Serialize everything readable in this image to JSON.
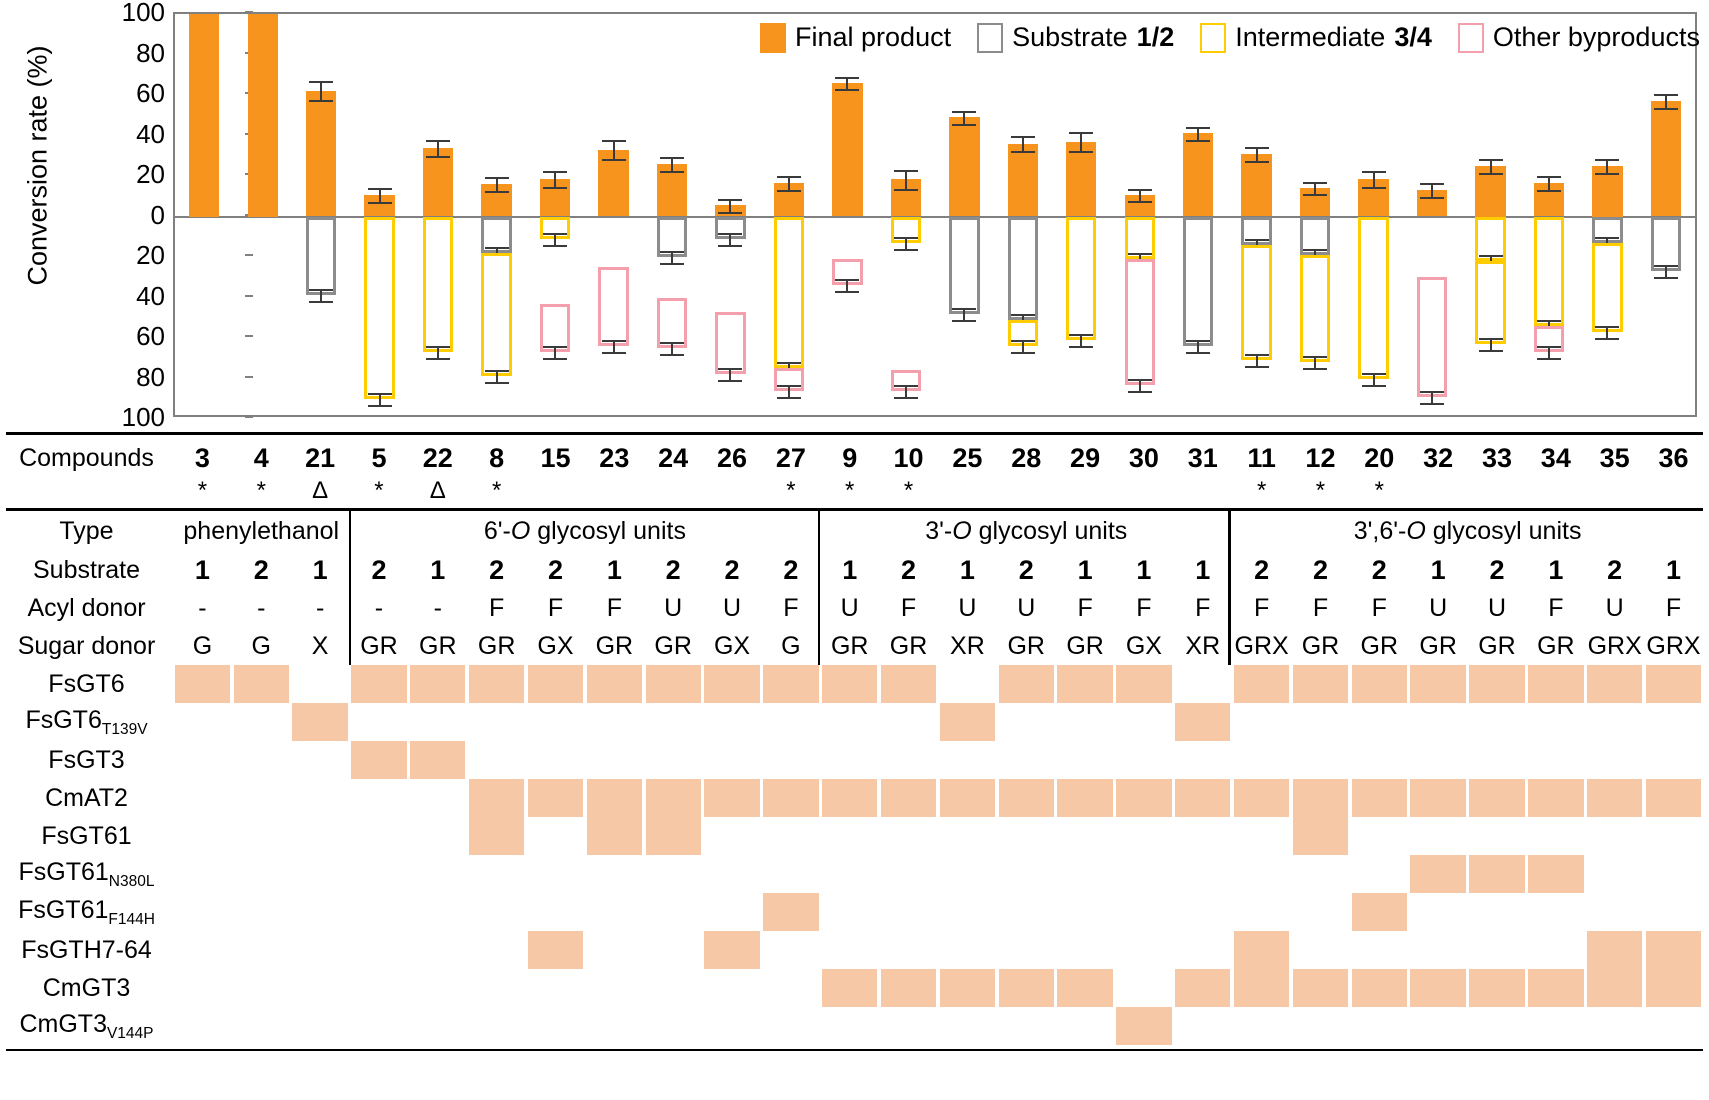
{
  "chart_data": {
    "type": "bar",
    "title": "",
    "ylabel": "Conversion rate (%)",
    "xlabel": "",
    "ylim": [
      -100,
      100
    ],
    "yticks": [
      100,
      80,
      60,
      40,
      20,
      0,
      20,
      40,
      60,
      80,
      100
    ],
    "grid": false,
    "legend_position": "top-right",
    "legend": [
      {
        "key": "final",
        "label": "Final product",
        "bold_suffix": "",
        "color": "#F7941D",
        "style": "filled"
      },
      {
        "key": "substrate",
        "label": "Substrate ",
        "bold_suffix": "1/2",
        "color": "#8C8C8C",
        "style": "outline"
      },
      {
        "key": "intermediate",
        "label": "Intermediate ",
        "bold_suffix": "3/4",
        "color": "#FFCC00",
        "style": "outline"
      },
      {
        "key": "other",
        "label": "Other byproducts",
        "bold_suffix": "",
        "color": "#F4A0AC",
        "style": "outline"
      }
    ],
    "categories": [
      "3",
      "4",
      "21",
      "5",
      "22",
      "8",
      "15",
      "23",
      "24",
      "26",
      "27",
      "9",
      "10",
      "25",
      "28",
      "29",
      "30",
      "31",
      "11",
      "12",
      "20",
      "32",
      "33",
      "34",
      "35",
      "36"
    ],
    "series": [
      {
        "name": "Final product",
        "values": [
          100,
          100,
          62,
          10.5,
          34,
          16,
          18.5,
          33,
          26,
          5.5,
          16.5,
          66,
          18.5,
          49,
          36,
          37,
          10.5,
          41,
          31,
          14,
          18.5,
          13,
          25,
          16.5,
          25,
          57
        ]
      },
      {
        "name": "Substrate 1/2",
        "values": [
          0,
          0,
          39,
          0,
          0,
          0,
          0,
          0,
          0,
          0,
          0,
          0,
          0,
          48,
          0,
          0,
          0,
          64,
          14,
          17,
          0,
          0,
          0,
          0,
          13,
          27
        ]
      },
      {
        "name": "Intermediate 3/4",
        "values": [
          0,
          0,
          0,
          90,
          67,
          22,
          11,
          0,
          20,
          11,
          0,
          20,
          13,
          0,
          51,
          61,
          21,
          0,
          52,
          55,
          80,
          0,
          62,
          0,
          57,
          0
        ]
      },
      {
        "name": "Other byproducts",
        "values": [
          0,
          0,
          0,
          0,
          0,
          0,
          56,
          64,
          0,
          55,
          76,
          34,
          67,
          0,
          0,
          0,
          59,
          0,
          0,
          0,
          0,
          90,
          0,
          54,
          0,
          0
        ]
      }
    ],
    "error_bars": [
      1.5,
      1.0,
      2.0,
      1.2,
      1.5,
      1.3,
      1.5,
      2.0,
      1.2,
      1.0,
      1.2,
      1.0,
      2.0,
      1.0,
      1.5,
      2.0,
      1.0,
      1.2,
      1.2,
      1.0,
      1.5,
      1.2,
      1.2,
      1.3,
      1.2,
      1.2
    ],
    "stacks": [
      {
        "compound": "3",
        "pos": [
          {
            "type": "final",
            "value": 100
          }
        ],
        "neg": []
      },
      {
        "compound": "4",
        "pos": [
          {
            "type": "final",
            "value": 100
          }
        ],
        "neg": []
      },
      {
        "compound": "21",
        "pos": [
          {
            "type": "final",
            "value": 62
          }
        ],
        "neg": [
          {
            "type": "substrate",
            "from": 0,
            "to": 39
          }
        ]
      },
      {
        "compound": "5",
        "pos": [
          {
            "type": "final",
            "value": 10.5
          }
        ],
        "neg": [
          {
            "type": "intermediate",
            "from": 0,
            "to": 90
          }
        ]
      },
      {
        "compound": "22",
        "pos": [
          {
            "type": "final",
            "value": 34
          }
        ],
        "neg": [
          {
            "type": "intermediate",
            "from": 0,
            "to": 67
          }
        ]
      },
      {
        "compound": "8",
        "pos": [
          {
            "type": "final",
            "value": 16
          }
        ],
        "neg": [
          {
            "type": "substrate",
            "from": 0,
            "to": 18
          },
          {
            "type": "intermediate",
            "from": 18,
            "to": 79
          }
        ]
      },
      {
        "compound": "15",
        "pos": [
          {
            "type": "final",
            "value": 18.5
          }
        ],
        "neg": [
          {
            "type": "intermediate",
            "from": 0,
            "to": 11
          },
          {
            "type": "other",
            "from": 43,
            "to": 67
          }
        ]
      },
      {
        "compound": "23",
        "pos": [
          {
            "type": "final",
            "value": 33
          }
        ],
        "neg": [
          {
            "type": "other",
            "from": 25,
            "to": 64
          }
        ]
      },
      {
        "compound": "24",
        "pos": [
          {
            "type": "final",
            "value": 26
          }
        ],
        "neg": [
          {
            "type": "substrate",
            "from": 0,
            "to": 20
          },
          {
            "type": "other",
            "from": 40,
            "to": 65
          }
        ]
      },
      {
        "compound": "26",
        "pos": [
          {
            "type": "final",
            "value": 5.5
          }
        ],
        "neg": [
          {
            "type": "substrate",
            "from": 0,
            "to": 11
          },
          {
            "type": "other",
            "from": 47,
            "to": 78
          }
        ]
      },
      {
        "compound": "27",
        "pos": [
          {
            "type": "final",
            "value": 16.5
          }
        ],
        "neg": [
          {
            "type": "intermediate",
            "from": 0,
            "to": 75
          },
          {
            "type": "other",
            "from": 75,
            "to": 86
          }
        ]
      },
      {
        "compound": "9",
        "pos": [
          {
            "type": "final",
            "value": 66
          }
        ],
        "neg": [
          {
            "type": "other",
            "from": 21,
            "to": 34
          }
        ]
      },
      {
        "compound": "10",
        "pos": [
          {
            "type": "final",
            "value": 18.5
          }
        ],
        "neg": [
          {
            "type": "intermediate",
            "from": 0,
            "to": 13
          },
          {
            "type": "other",
            "from": 76,
            "to": 86
          }
        ]
      },
      {
        "compound": "25",
        "pos": [
          {
            "type": "final",
            "value": 49
          }
        ],
        "neg": [
          {
            "type": "substrate",
            "from": 0,
            "to": 48
          }
        ]
      },
      {
        "compound": "28",
        "pos": [
          {
            "type": "final",
            "value": 36
          }
        ],
        "neg": [
          {
            "type": "substrate",
            "from": 0,
            "to": 51
          },
          {
            "type": "intermediate",
            "from": 51,
            "to": 64
          }
        ]
      },
      {
        "compound": "29",
        "pos": [
          {
            "type": "final",
            "value": 37
          }
        ],
        "neg": [
          {
            "type": "intermediate",
            "from": 0,
            "to": 61
          }
        ]
      },
      {
        "compound": "30",
        "pos": [
          {
            "type": "final",
            "value": 10.5
          }
        ],
        "neg": [
          {
            "type": "intermediate",
            "from": 0,
            "to": 21
          },
          {
            "type": "other",
            "from": 21,
            "to": 83
          }
        ]
      },
      {
        "compound": "31",
        "pos": [
          {
            "type": "final",
            "value": 41
          }
        ],
        "neg": [
          {
            "type": "substrate",
            "from": 0,
            "to": 64
          }
        ]
      },
      {
        "compound": "11",
        "pos": [
          {
            "type": "final",
            "value": 31
          }
        ],
        "neg": [
          {
            "type": "substrate",
            "from": 0,
            "to": 14
          },
          {
            "type": "intermediate",
            "from": 14,
            "to": 71
          }
        ]
      },
      {
        "compound": "12",
        "pos": [
          {
            "type": "final",
            "value": 14
          }
        ],
        "neg": [
          {
            "type": "substrate",
            "from": 0,
            "to": 19
          },
          {
            "type": "intermediate",
            "from": 19,
            "to": 72
          }
        ]
      },
      {
        "compound": "20",
        "pos": [
          {
            "type": "final",
            "value": 18.5
          }
        ],
        "neg": [
          {
            "type": "intermediate",
            "from": 0,
            "to": 80
          }
        ]
      },
      {
        "compound": "32",
        "pos": [
          {
            "type": "final",
            "value": 13
          }
        ],
        "neg": [
          {
            "type": "other",
            "from": 30,
            "to": 89
          }
        ]
      },
      {
        "compound": "33",
        "pos": [
          {
            "type": "final",
            "value": 25
          }
        ],
        "neg": [
          {
            "type": "intermediate",
            "from": 0,
            "to": 22
          },
          {
            "type": "intermediate",
            "from": 22,
            "to": 63
          }
        ]
      },
      {
        "compound": "34",
        "pos": [
          {
            "type": "final",
            "value": 16.5
          }
        ],
        "neg": [
          {
            "type": "intermediate",
            "from": 0,
            "to": 54
          },
          {
            "type": "other",
            "from": 54,
            "to": 67
          }
        ]
      },
      {
        "compound": "35",
        "pos": [
          {
            "type": "final",
            "value": 25
          }
        ],
        "neg": [
          {
            "type": "substrate",
            "from": 0,
            "to": 13
          },
          {
            "type": "intermediate",
            "from": 13,
            "to": 57
          }
        ]
      },
      {
        "compound": "36",
        "pos": [
          {
            "type": "final",
            "value": 57
          }
        ],
        "neg": [
          {
            "type": "substrate",
            "from": 0,
            "to": 27
          }
        ]
      }
    ]
  },
  "table": {
    "row_labels": {
      "compounds": "Compounds",
      "type": "Type",
      "substrate": "Substrate",
      "acyl_donor": "Acyl donor",
      "sugar_donor": "Sugar donor"
    },
    "compounds": [
      "3",
      "4",
      "21",
      "5",
      "22",
      "8",
      "15",
      "23",
      "24",
      "26",
      "27",
      "9",
      "10",
      "25",
      "28",
      "29",
      "30",
      "31",
      "11",
      "12",
      "20",
      "32",
      "33",
      "34",
      "35",
      "36"
    ],
    "marks": [
      "*",
      "*",
      "Δ",
      "*",
      "Δ",
      "*",
      "",
      "",
      "",
      "",
      "*",
      "*",
      "*",
      "",
      "",
      "",
      "",
      "",
      "*",
      "*",
      "*",
      "",
      "",
      "",
      "",
      ""
    ],
    "type_groups": [
      {
        "label": "phenylethanol",
        "span": 3,
        "italic_prefix": ""
      },
      {
        "label": "6'-O glycosyl units",
        "span": 8
      },
      {
        "label": "3'-O glycosyl units",
        "span": 7
      },
      {
        "label": "3',6'-O glycosyl units",
        "span": 8
      }
    ],
    "substrate": [
      "1",
      "2",
      "1",
      "2",
      "1",
      "2",
      "2",
      "1",
      "2",
      "2",
      "2",
      "1",
      "2",
      "1",
      "2",
      "1",
      "1",
      "1",
      "2",
      "2",
      "2",
      "1",
      "2",
      "1",
      "2",
      "1"
    ],
    "acyl_donor": [
      "-",
      "-",
      "-",
      "-",
      "-",
      "F",
      "F",
      "F",
      "U",
      "U",
      "F",
      "U",
      "F",
      "U",
      "U",
      "F",
      "F",
      "F",
      "F",
      "F",
      "F",
      "U",
      "U",
      "F",
      "U",
      "F"
    ],
    "sugar_donor": [
      "G",
      "G",
      "X",
      "GR",
      "GR",
      "GR",
      "GX",
      "GR",
      "GR",
      "GX",
      "G",
      "GR",
      "GR",
      "XR",
      "GR",
      "GR",
      "GX",
      "XR",
      "GRX",
      "GR",
      "GR",
      "GR",
      "GR",
      "GR",
      "GRX",
      "GRX"
    ],
    "enzymes": [
      {
        "name": "FsGT6",
        "sub": "",
        "cells": [
          1,
          1,
          0,
          1,
          1,
          1,
          1,
          1,
          1,
          1,
          1,
          1,
          1,
          0,
          1,
          1,
          1,
          0,
          1,
          1,
          1,
          1,
          1,
          1,
          1,
          1
        ]
      },
      {
        "name": "FsGT6",
        "sub": "T139V",
        "cells": [
          0,
          0,
          1,
          0,
          0,
          0,
          0,
          0,
          0,
          0,
          0,
          0,
          0,
          1,
          0,
          0,
          0,
          1,
          0,
          0,
          0,
          0,
          0,
          0,
          0,
          0
        ]
      },
      {
        "name": "FsGT3",
        "sub": "",
        "cells": [
          0,
          0,
          0,
          1,
          1,
          0,
          0,
          0,
          0,
          0,
          0,
          0,
          0,
          0,
          0,
          0,
          0,
          0,
          0,
          0,
          0,
          0,
          0,
          0,
          0,
          0
        ]
      },
      {
        "name": "CmAT2",
        "sub": "",
        "cells": [
          0,
          0,
          0,
          0,
          0,
          1,
          1,
          1,
          1,
          1,
          1,
          1,
          1,
          1,
          1,
          1,
          1,
          1,
          1,
          1,
          1,
          1,
          1,
          1,
          1,
          1
        ]
      },
      {
        "name": "FsGT61",
        "sub": "",
        "cells": [
          0,
          0,
          0,
          0,
          0,
          1,
          0,
          1,
          1,
          0,
          0,
          0,
          0,
          0,
          0,
          0,
          0,
          0,
          0,
          1,
          0,
          0,
          0,
          0,
          0,
          0
        ]
      },
      {
        "name": "FsGT61",
        "sub": "N380L",
        "cells": [
          0,
          0,
          0,
          0,
          0,
          0,
          0,
          0,
          0,
          0,
          0,
          0,
          0,
          0,
          0,
          0,
          0,
          0,
          0,
          0,
          0,
          1,
          1,
          1,
          0,
          0
        ]
      },
      {
        "name": "FsGT61",
        "sub": "F144H",
        "cells": [
          0,
          0,
          0,
          0,
          0,
          0,
          0,
          0,
          0,
          0,
          1,
          0,
          0,
          0,
          0,
          0,
          0,
          0,
          0,
          0,
          1,
          0,
          0,
          0,
          0,
          0
        ]
      },
      {
        "name": "FsGTH7-64",
        "sub": "",
        "cells": [
          0,
          0,
          0,
          0,
          0,
          0,
          1,
          0,
          0,
          1,
          0,
          0,
          0,
          0,
          0,
          0,
          0,
          0,
          1,
          0,
          0,
          0,
          0,
          0,
          1,
          1
        ]
      },
      {
        "name": "CmGT3",
        "sub": "",
        "cells": [
          0,
          0,
          0,
          0,
          0,
          0,
          0,
          0,
          0,
          0,
          0,
          1,
          1,
          1,
          1,
          1,
          0,
          1,
          1,
          1,
          1,
          1,
          1,
          1,
          1,
          1
        ]
      },
      {
        "name": "CmGT3",
        "sub": "V144P",
        "cells": [
          0,
          0,
          0,
          0,
          0,
          0,
          0,
          0,
          0,
          0,
          0,
          0,
          0,
          0,
          0,
          0,
          1,
          0,
          0,
          0,
          0,
          0,
          0,
          0,
          0,
          0
        ]
      }
    ],
    "group_separators_after": [
      3,
      11,
      18
    ]
  },
  "colors": {
    "final_product": "#F7941D",
    "substrate_outline": "#8C8C8C",
    "intermediate_outline": "#FFCC00",
    "other_outline": "#F4A0AC",
    "swatch": "#F7C8A6",
    "axis": "#808080"
  }
}
